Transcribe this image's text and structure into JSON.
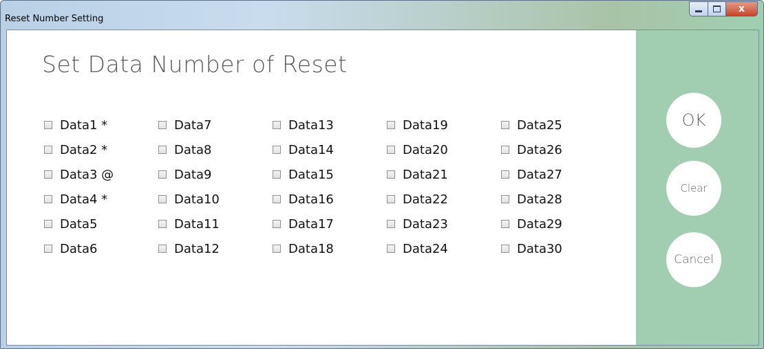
{
  "window": {
    "title": "Reset Number Setting",
    "controls": {
      "minimize": "",
      "maximize": "",
      "close": "x"
    }
  },
  "heading": "Set Data Number of Reset",
  "checkboxes": [
    {
      "label": "Data1 *",
      "checked": false
    },
    {
      "label": "Data2 *",
      "checked": false
    },
    {
      "label": "Data3 @",
      "checked": false
    },
    {
      "label": "Data4 *",
      "checked": false
    },
    {
      "label": "Data5",
      "checked": false
    },
    {
      "label": "Data6",
      "checked": false
    },
    {
      "label": "Data7",
      "checked": false
    },
    {
      "label": "Data8",
      "checked": false
    },
    {
      "label": "Data9",
      "checked": false
    },
    {
      "label": "Data10",
      "checked": false
    },
    {
      "label": "Data11",
      "checked": false
    },
    {
      "label": "Data12",
      "checked": false
    },
    {
      "label": "Data13",
      "checked": false
    },
    {
      "label": "Data14",
      "checked": false
    },
    {
      "label": "Data15",
      "checked": false
    },
    {
      "label": "Data16",
      "checked": false
    },
    {
      "label": "Data17",
      "checked": false
    },
    {
      "label": "Data18",
      "checked": false
    },
    {
      "label": "Data19",
      "checked": false
    },
    {
      "label": "Data20",
      "checked": false
    },
    {
      "label": "Data21",
      "checked": false
    },
    {
      "label": "Data22",
      "checked": false
    },
    {
      "label": "Data23",
      "checked": false
    },
    {
      "label": "Data24",
      "checked": false
    },
    {
      "label": "Data25",
      "checked": false
    },
    {
      "label": "Data26",
      "checked": false
    },
    {
      "label": "Data27",
      "checked": false
    },
    {
      "label": "Data28",
      "checked": false
    },
    {
      "label": "Data29",
      "checked": false
    },
    {
      "label": "Data30",
      "checked": false
    }
  ],
  "buttons": {
    "ok": "OK",
    "clear": "Clear",
    "cancel": "Cancel"
  },
  "colors": {
    "side_panel": "#a1cdb1",
    "button_bg": "#ffffff",
    "heading_text": "#5a5a5a"
  }
}
